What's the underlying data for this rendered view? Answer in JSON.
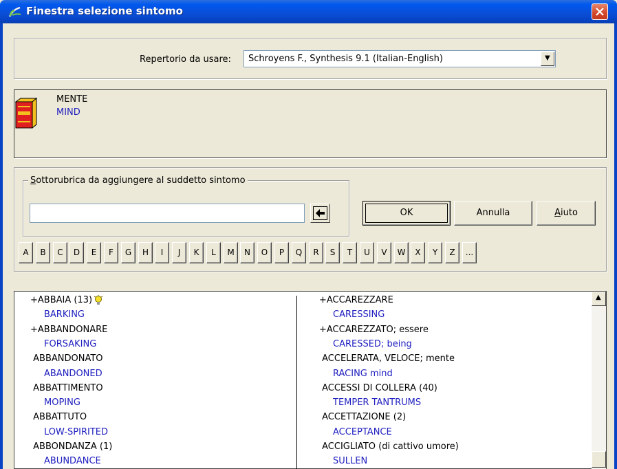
{
  "window": {
    "title": "Finestra selezione sintomo"
  },
  "repertory": {
    "label": "Repertorio da usare:",
    "selected": "Schroyens F., Synthesis 9.1 (Italian-English)"
  },
  "symptom": {
    "italian": "MENTE",
    "english": "MIND"
  },
  "subrubric": {
    "group_label": "Sottorubrica da aggiungere al suddetto sintomo",
    "input_value": ""
  },
  "buttons": {
    "ok": "OK",
    "cancel": "Annulla",
    "help_prefix": "",
    "help_underlined": "A",
    "help_rest": "iuto"
  },
  "alphabet": [
    "A",
    "B",
    "C",
    "D",
    "E",
    "F",
    "G",
    "H",
    "I",
    "J",
    "K",
    "L",
    "M",
    "N",
    "O",
    "P",
    "Q",
    "R",
    "S",
    "T",
    "U",
    "V",
    "W",
    "X",
    "Y",
    "Z",
    "..."
  ],
  "list": {
    "left": [
      {
        "it": "+ABBAIA (13)",
        "en": "BARKING",
        "bulb": true
      },
      {
        "it": "+ABBANDONARE",
        "en": "FORSAKING"
      },
      {
        "it": " ABBANDONATO",
        "en": "ABANDONED"
      },
      {
        "it": " ABBATTIMENTO",
        "en": "MOPING"
      },
      {
        "it": " ABBATTUTO",
        "en": "LOW-SPIRITED"
      },
      {
        "it": " ABBONDANZA (1)",
        "en": "ABUNDANCE"
      }
    ],
    "right": [
      {
        "it": "+ACCAREZZARE",
        "en": "CARESSING"
      },
      {
        "it": "+ACCAREZZATO; essere",
        "en": "CARESSED; being"
      },
      {
        "it": " ACCELERATA, VELOCE; mente",
        "en": "RACING mind"
      },
      {
        "it": " ACCESSI DI COLLERA (40)",
        "en": "TEMPER TANTRUMS"
      },
      {
        "it": " ACCETTAZIONE (2)",
        "en": "ACCEPTANCE"
      },
      {
        "it": " ACCIGLIATO (di cattivo umore)",
        "en": "SULLEN"
      }
    ]
  }
}
